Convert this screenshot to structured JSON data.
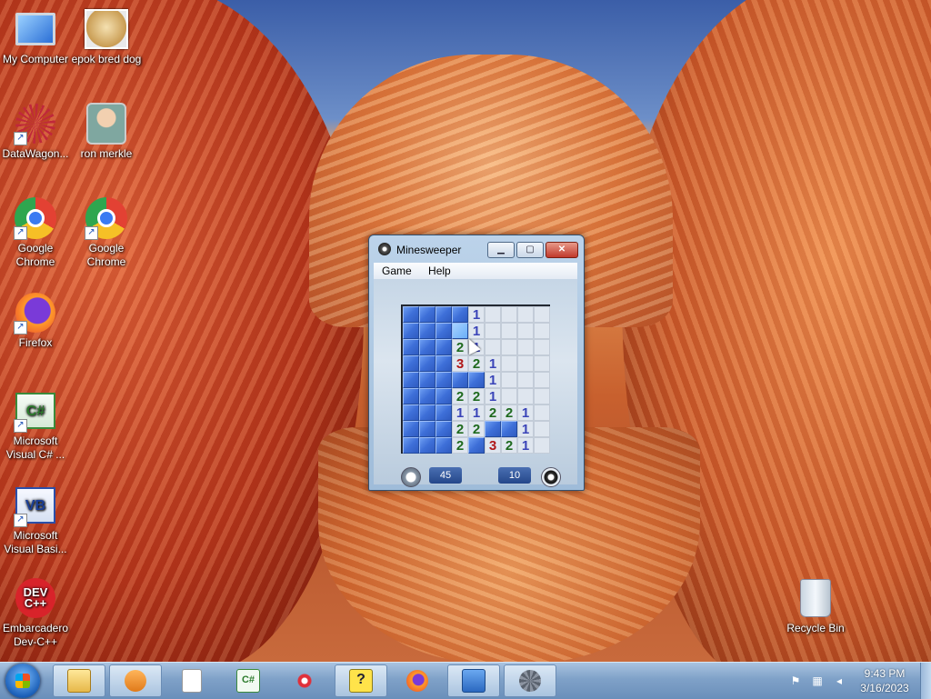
{
  "desktop": {
    "icons": [
      {
        "label": "My Computer",
        "icon": "computer-icon"
      },
      {
        "label": "epok bred dog",
        "icon": "doge-image-icon"
      },
      {
        "label": "DataWagon...",
        "icon": "datawagon-icon"
      },
      {
        "label": "ron merkle",
        "icon": "user-icon"
      },
      {
        "label": "Google Chrome",
        "icon": "chrome-icon"
      },
      {
        "label": "Google Chrome",
        "icon": "chrome-icon"
      },
      {
        "label": "Firefox",
        "icon": "firefox-icon"
      },
      {
        "label": "Microsoft Visual C# ...",
        "icon": "visual-csharp-icon"
      },
      {
        "label": "Microsoft Visual Basi...",
        "icon": "visual-basic-icon"
      },
      {
        "label": "Embarcadero Dev-C++",
        "icon": "devcpp-icon"
      },
      {
        "label": "Recycle Bin",
        "icon": "recycle-bin-icon"
      }
    ]
  },
  "minesweeper": {
    "title": "Minesweeper",
    "menu": [
      "Game",
      "Help"
    ],
    "board": [
      [
        "c",
        "c",
        "c",
        "c",
        "1",
        "o",
        "o",
        "o",
        "o"
      ],
      [
        "c",
        "c",
        "c",
        "h",
        "1",
        "o",
        "o",
        "o",
        "o"
      ],
      [
        "c",
        "c",
        "c",
        "2",
        "1",
        "o",
        "o",
        "o",
        "o"
      ],
      [
        "c",
        "c",
        "c",
        "3",
        "2",
        "1",
        "o",
        "o",
        "o"
      ],
      [
        "c",
        "c",
        "c",
        "c",
        "c",
        "1",
        "o",
        "o",
        "o"
      ],
      [
        "c",
        "c",
        "c",
        "2",
        "2",
        "1",
        "o",
        "o",
        "o"
      ],
      [
        "c",
        "c",
        "c",
        "1",
        "1",
        "2",
        "2",
        "1",
        "o"
      ],
      [
        "c",
        "c",
        "c",
        "2",
        "2",
        "c",
        "c",
        "1",
        "o"
      ],
      [
        "c",
        "c",
        "c",
        "2",
        "c",
        "3",
        "2",
        "1",
        "o"
      ]
    ],
    "time": "45",
    "mines": "10"
  },
  "taskbar": {
    "buttons": [
      "windows-explorer",
      "media-center",
      "blank-document",
      "visual-csharp",
      "snipping-tool",
      "help-and-support",
      "firefox",
      "control-panel",
      "minesweeper"
    ],
    "clock_time": "9:43 PM",
    "clock_date": "3/16/2023"
  }
}
